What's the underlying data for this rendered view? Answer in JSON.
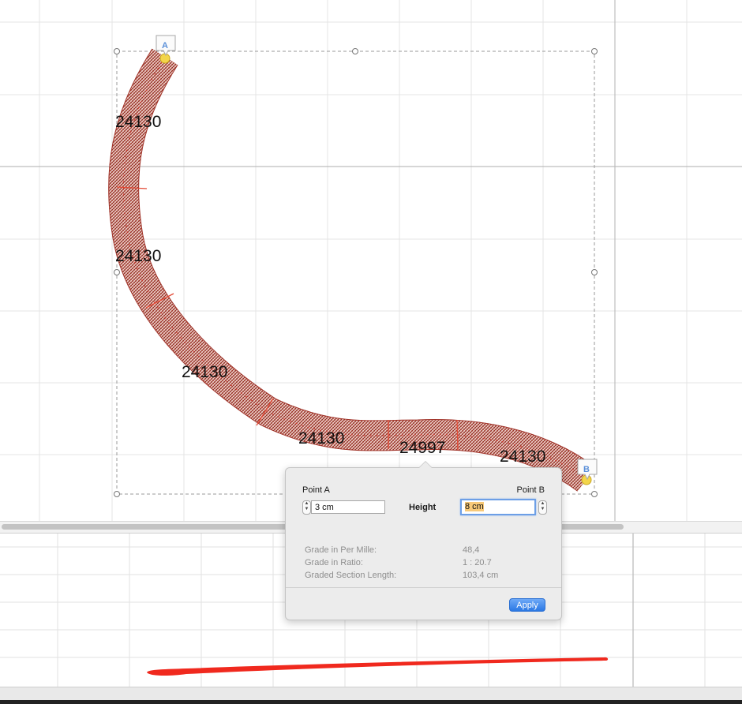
{
  "track": {
    "section_lengths": [
      "24130",
      "24130",
      "24130",
      "24130",
      "24997",
      "24130"
    ],
    "point_a_marker": "A",
    "point_b_marker": "B"
  },
  "popover": {
    "point_a_label": "Point A",
    "point_b_label": "Point B",
    "height_label": "Height",
    "point_a_value": "3 cm",
    "point_b_value": "8 cm",
    "info": [
      {
        "label": "Grade in Per Mille:",
        "value": "48,4"
      },
      {
        "label": "Grade in Ratio:",
        "value": "1 : 20.7"
      },
      {
        "label": "Graded Section Length:",
        "value": "103,4 cm"
      }
    ],
    "apply_label": "Apply"
  },
  "colors": {
    "track_fill": "#a03228",
    "track_tie": "#e34a36",
    "accent": "#2b78e4",
    "annotation": "#f0291e"
  }
}
